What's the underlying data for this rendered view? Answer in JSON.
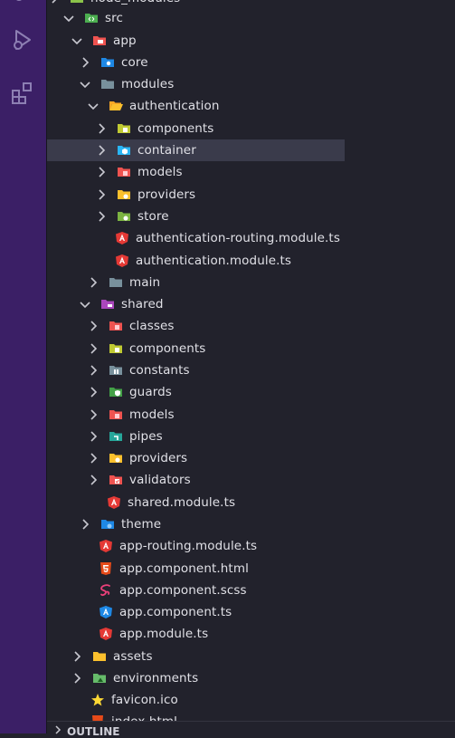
{
  "activity_bar": {
    "icons": [
      "source-control-icon",
      "run-debug-icon",
      "extensions-icon"
    ]
  },
  "explorer": {
    "rows": [
      {
        "label": "node_modules",
        "icon": "folder-node",
        "open": false
      },
      {
        "label": "src",
        "icon": "folder-src",
        "open": true
      },
      {
        "label": "app",
        "icon": "folder-app",
        "open": true
      },
      {
        "label": "core",
        "icon": "folder-core",
        "open": false
      },
      {
        "label": "modules",
        "icon": "folder-modules",
        "open": true
      },
      {
        "label": "authentication",
        "icon": "folder-open-yellow",
        "open": true
      },
      {
        "label": "components",
        "icon": "folder-components",
        "open": false
      },
      {
        "label": "container",
        "icon": "folder-container",
        "open": false,
        "selected": true
      },
      {
        "label": "models",
        "icon": "folder-models",
        "open": false
      },
      {
        "label": "providers",
        "icon": "folder-providers",
        "open": false
      },
      {
        "label": "store",
        "icon": "folder-store",
        "open": false
      },
      {
        "label": "authentication-routing.module.ts",
        "icon": "angular-file"
      },
      {
        "label": "authentication.module.ts",
        "icon": "angular-file"
      },
      {
        "label": "main",
        "icon": "folder-main",
        "open": false
      },
      {
        "label": "shared",
        "icon": "folder-shared",
        "open": true
      },
      {
        "label": "classes",
        "icon": "folder-classes",
        "open": false
      },
      {
        "label": "components",
        "icon": "folder-components",
        "open": false
      },
      {
        "label": "constants",
        "icon": "folder-constants",
        "open": false
      },
      {
        "label": "guards",
        "icon": "folder-guards",
        "open": false
      },
      {
        "label": "models",
        "icon": "folder-models",
        "open": false
      },
      {
        "label": "pipes",
        "icon": "folder-pipes",
        "open": false
      },
      {
        "label": "providers",
        "icon": "folder-providers",
        "open": false
      },
      {
        "label": "validators",
        "icon": "folder-validators",
        "open": false
      },
      {
        "label": "shared.module.ts",
        "icon": "angular-file"
      },
      {
        "label": "theme",
        "icon": "folder-theme",
        "open": false
      },
      {
        "label": "app-routing.module.ts",
        "icon": "angular-file"
      },
      {
        "label": "app.component.html",
        "icon": "html-file"
      },
      {
        "label": "app.component.scss",
        "icon": "scss-file"
      },
      {
        "label": "app.component.ts",
        "icon": "angular-component-file"
      },
      {
        "label": "app.module.ts",
        "icon": "angular-file"
      },
      {
        "label": "assets",
        "icon": "folder-assets",
        "open": false
      },
      {
        "label": "environments",
        "icon": "folder-environments",
        "open": false
      },
      {
        "label": "favicon.ico",
        "icon": "favicon-star"
      },
      {
        "label": "index.html",
        "icon": "html-file"
      }
    ]
  },
  "outline": {
    "label": "OUTLINE"
  },
  "colors": {
    "activity_bar": "#3b1f66",
    "sidebar_bg": "#22222c",
    "selection": "#3a3b4b",
    "text": "#e0e0e6"
  }
}
